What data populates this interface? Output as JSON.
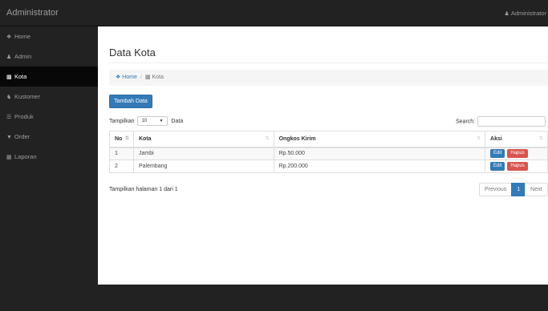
{
  "topbar": {
    "brand": "Administrator",
    "user_icon": "user-icon",
    "user_label": "Administrator"
  },
  "sidebar": {
    "items": [
      {
        "icon": "home-icon",
        "label": "Home",
        "active": false
      },
      {
        "icon": "user-icon",
        "label": "Admin",
        "active": false
      },
      {
        "icon": "car-icon",
        "label": "Kota",
        "active": true
      },
      {
        "icon": "users-icon",
        "label": "Kustomer",
        "active": false
      },
      {
        "icon": "database-icon",
        "label": "Produk",
        "active": false
      },
      {
        "icon": "cart-icon",
        "label": "Order",
        "active": false
      },
      {
        "icon": "book-icon",
        "label": "Laporan",
        "active": false
      }
    ]
  },
  "main": {
    "title": "Data Kota",
    "breadcrumb": {
      "home_icon": "home-icon",
      "home": "Home",
      "separator": "/",
      "current_icon": "car-icon",
      "current": "Kota"
    },
    "add_button": "Tambah Data",
    "length": {
      "prefix": "Tampilkan",
      "value": "10",
      "suffix": "Data"
    },
    "search": {
      "label": "Search:",
      "value": ""
    },
    "table": {
      "headers": [
        "No",
        "Kota",
        "Ongkos Kirim",
        "Aksi"
      ],
      "rows": [
        {
          "no": "1",
          "kota": "Jambi",
          "ongkir": "Rp.50.000"
        },
        {
          "no": "2",
          "kota": "Palembang",
          "ongkir": "Rp.200.000"
        }
      ],
      "edit_label": "Edit",
      "delete_label": "Hapus"
    },
    "info": "Tampilkan halaman 1 dari 1",
    "pagination": {
      "previous": "Previous",
      "page": "1",
      "next": "Next"
    }
  },
  "colors": {
    "navbar": "#222222",
    "sidebar_active": "#080808",
    "primary": "#337ab7",
    "danger": "#d9534f"
  }
}
